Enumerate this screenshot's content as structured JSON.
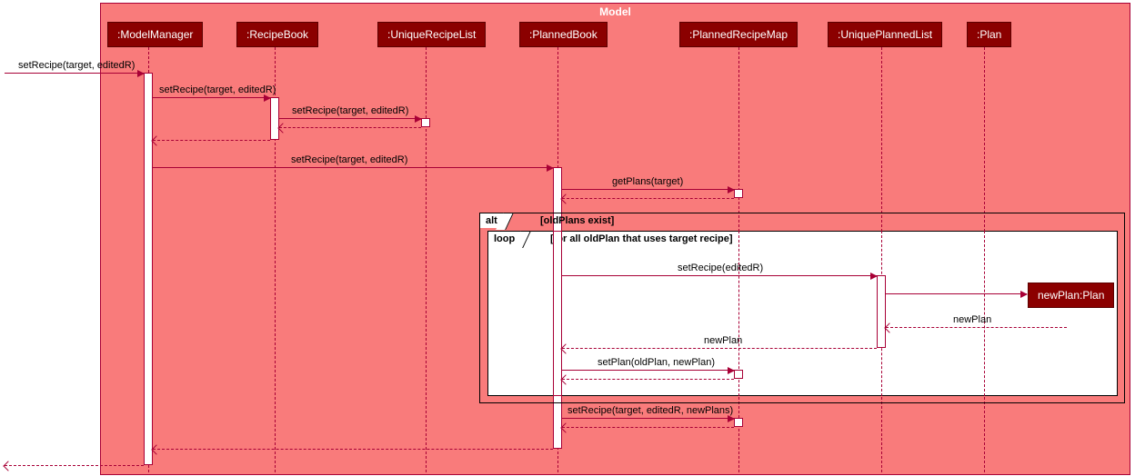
{
  "frame_title": "Model",
  "participants": {
    "modelManager": ":ModelManager",
    "recipeBook": ":RecipeBook",
    "uniqueRecipeList": ":UniqueRecipeList",
    "plannedBook": ":PlannedBook",
    "plannedRecipeMap": ":PlannedRecipeMap",
    "uniquePlannedList": ":UniquePlannedList",
    "plan": ":Plan",
    "newPlan": "newPlan:Plan"
  },
  "messages": {
    "m1": "setRecipe(target, editedR)",
    "m2": "setRecipe(target, editedR)",
    "m3": "setRecipe(target, editedR)",
    "m4": "setRecipe(target, editedR)",
    "m5": "getPlans(target)",
    "m6": "setRecipe(editedR)",
    "m7": "newPlan",
    "m8": "newPlan",
    "m9": "setPlan(oldPlan, newPlan)",
    "m10": "setRecipe(target, editedR, newPlans)"
  },
  "fragments": {
    "alt": {
      "label": "alt",
      "guard": "[oldPlans exist]"
    },
    "loop": {
      "label": "loop",
      "guard": "[for all oldPlan that uses target recipe]"
    }
  },
  "chart_data": {
    "type": "sequence-diagram",
    "frame": "Model",
    "participants": [
      ":ModelManager",
      ":RecipeBook",
      ":UniqueRecipeList",
      ":PlannedBook",
      ":PlannedRecipeMap",
      ":UniquePlannedList",
      ":Plan"
    ],
    "created_objects": [
      "newPlan:Plan"
    ],
    "messages": [
      {
        "from": "EXTERNAL",
        "to": ":ModelManager",
        "label": "setRecipe(target, editedR)",
        "type": "sync"
      },
      {
        "from": ":ModelManager",
        "to": ":RecipeBook",
        "label": "setRecipe(target, editedR)",
        "type": "sync"
      },
      {
        "from": ":RecipeBook",
        "to": ":UniqueRecipeList",
        "label": "setRecipe(target, editedR)",
        "type": "sync"
      },
      {
        "from": ":UniqueRecipeList",
        "to": ":RecipeBook",
        "label": "",
        "type": "return"
      },
      {
        "from": ":RecipeBook",
        "to": ":ModelManager",
        "label": "",
        "type": "return"
      },
      {
        "from": ":ModelManager",
        "to": ":PlannedBook",
        "label": "setRecipe(target, editedR)",
        "type": "sync"
      },
      {
        "from": ":PlannedBook",
        "to": ":PlannedRecipeMap",
        "label": "getPlans(target)",
        "type": "sync"
      },
      {
        "from": ":PlannedRecipeMap",
        "to": ":PlannedBook",
        "label": "",
        "type": "return"
      },
      {
        "fragment": "alt",
        "guard": "[oldPlans exist]",
        "contains": [
          {
            "fragment": "loop",
            "guard": "[for all oldPlan that uses target recipe]",
            "contains": [
              {
                "from": ":PlannedBook",
                "to": ":UniquePlannedList",
                "label": "setRecipe(editedR)",
                "type": "sync"
              },
              {
                "from": ":UniquePlannedList",
                "to": "newPlan:Plan",
                "label": "",
                "type": "create"
              },
              {
                "from": "newPlan:Plan",
                "to": ":UniquePlannedList",
                "label": "newPlan",
                "type": "return"
              },
              {
                "from": ":UniquePlannedList",
                "to": ":PlannedBook",
                "label": "newPlan",
                "type": "return"
              },
              {
                "from": ":PlannedBook",
                "to": ":PlannedRecipeMap",
                "label": "setPlan(oldPlan, newPlan)",
                "type": "sync"
              },
              {
                "from": ":PlannedRecipeMap",
                "to": ":PlannedBook",
                "label": "",
                "type": "return"
              }
            ]
          }
        ]
      },
      {
        "from": ":PlannedBook",
        "to": ":PlannedRecipeMap",
        "label": "setRecipe(target, editedR, newPlans)",
        "type": "sync"
      },
      {
        "from": ":PlannedRecipeMap",
        "to": ":PlannedBook",
        "label": "",
        "type": "return"
      },
      {
        "from": ":PlannedBook",
        "to": ":ModelManager",
        "label": "",
        "type": "return"
      },
      {
        "from": ":ModelManager",
        "to": "EXTERNAL",
        "label": "",
        "type": "return"
      }
    ]
  }
}
